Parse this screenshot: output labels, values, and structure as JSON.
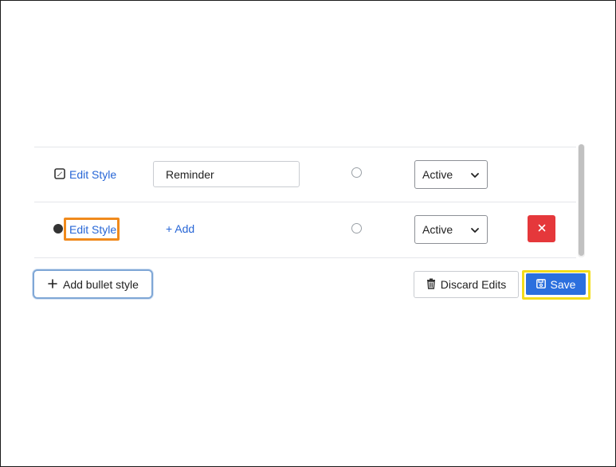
{
  "rows": [
    {
      "edit_style_label": "Edit Style",
      "name_value": "Reminder",
      "status_value": "Active",
      "leading_icon": "edit-square-icon"
    },
    {
      "edit_style_label": "Edit Style",
      "add_label": "+ Add",
      "status_value": "Active",
      "leading_icon": "bullet-dot-icon",
      "delete_icon": "close-icon"
    }
  ],
  "footer": {
    "add_bullet_label": "Add bullet style",
    "discard_label": "Discard Edits",
    "save_label": "Save"
  },
  "colors": {
    "link": "#2766d6",
    "delete": "#e5383b",
    "save": "#2b6fde",
    "highlight_orange": "#f08a1c",
    "highlight_yellow": "#f3dc1b",
    "focus_outline": "#7fa7d6"
  }
}
